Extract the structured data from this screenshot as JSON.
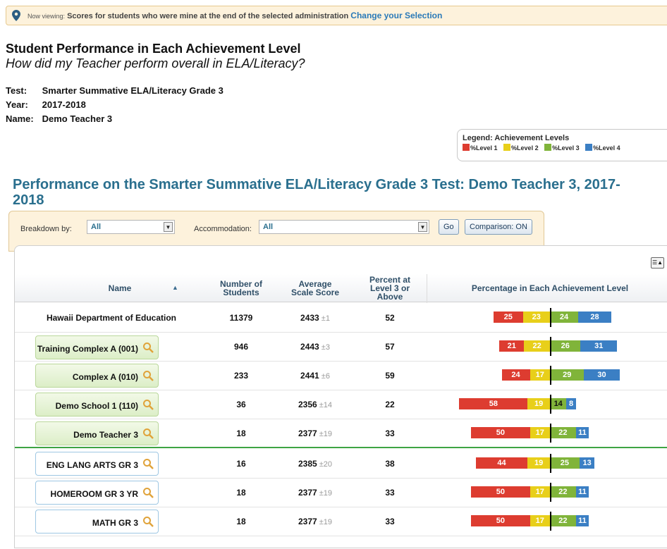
{
  "banner": {
    "label": "Now viewing:",
    "message": "Scores for students who were mine at the end of the selected administration",
    "link": "Change your Selection"
  },
  "report": {
    "title": "Student Performance in Each Achievement Level",
    "subtitle": "How did my Teacher perform overall in ELA/Literacy?",
    "test_key": "Test:",
    "test": "Smarter Summative ELA/Literacy Grade 3",
    "year_key": "Year:",
    "year": "2017-2018",
    "name_key": "Name:",
    "name": "Demo Teacher 3"
  },
  "legend": {
    "title": "Legend: Achievement Levels",
    "items": [
      {
        "label": "%Level 1",
        "color": "#dd3c30"
      },
      {
        "label": "%Level 2",
        "color": "#e8cf1a"
      },
      {
        "label": "%Level 3",
        "color": "#80b43a"
      },
      {
        "label": "%Level 4",
        "color": "#3b7fc4"
      }
    ]
  },
  "performance_title": "Performance on the Smarter Summative ELA/Literacy Grade 3 Test: Demo Teacher 3, 2017-2018",
  "filters": {
    "breakdown_label": "Breakdown by:",
    "breakdown_value": "All",
    "accommodation_label": "Accommodation:",
    "accommodation_value": "All",
    "go": "Go",
    "comparison": "Comparison: ON"
  },
  "table": {
    "headers": {
      "name": "Name",
      "students": "Number of Students",
      "avg": "Average Scale Score",
      "pct": "Percent at Level 3 or Above",
      "dist": "Percentage in Each Achievement Level"
    },
    "rows": [
      {
        "name": "Hawaii Department of Education",
        "n": "11379",
        "score": "2433",
        "err": "±1",
        "pct": "52",
        "levels": [
          25,
          23,
          24,
          28
        ]
      },
      {
        "name": "Training Complex A (001)",
        "n": "946",
        "score": "2443",
        "err": "±3",
        "pct": "57",
        "levels": [
          21,
          22,
          26,
          31
        ]
      },
      {
        "name": "Complex A (010)",
        "n": "233",
        "score": "2441",
        "err": "±6",
        "pct": "59",
        "levels": [
          24,
          17,
          29,
          30
        ]
      },
      {
        "name": "Demo School 1 (110)",
        "n": "36",
        "score": "2356",
        "err": "±14",
        "pct": "22",
        "levels": [
          58,
          19,
          14,
          8
        ]
      },
      {
        "name": "Demo Teacher 3",
        "n": "18",
        "score": "2377",
        "err": "±19",
        "pct": "33",
        "levels": [
          50,
          17,
          22,
          11
        ]
      },
      {
        "name": "ENG LANG ARTS GR 3",
        "n": "16",
        "score": "2385",
        "err": "±20",
        "pct": "38",
        "levels": [
          44,
          19,
          25,
          13
        ]
      },
      {
        "name": "HOMEROOM GR 3 YR",
        "n": "18",
        "score": "2377",
        "err": "±19",
        "pct": "33",
        "levels": [
          50,
          17,
          22,
          11
        ]
      },
      {
        "name": "MATH GR 3",
        "n": "18",
        "score": "2377",
        "err": "±19",
        "pct": "33",
        "levels": [
          50,
          17,
          22,
          11
        ]
      }
    ]
  }
}
